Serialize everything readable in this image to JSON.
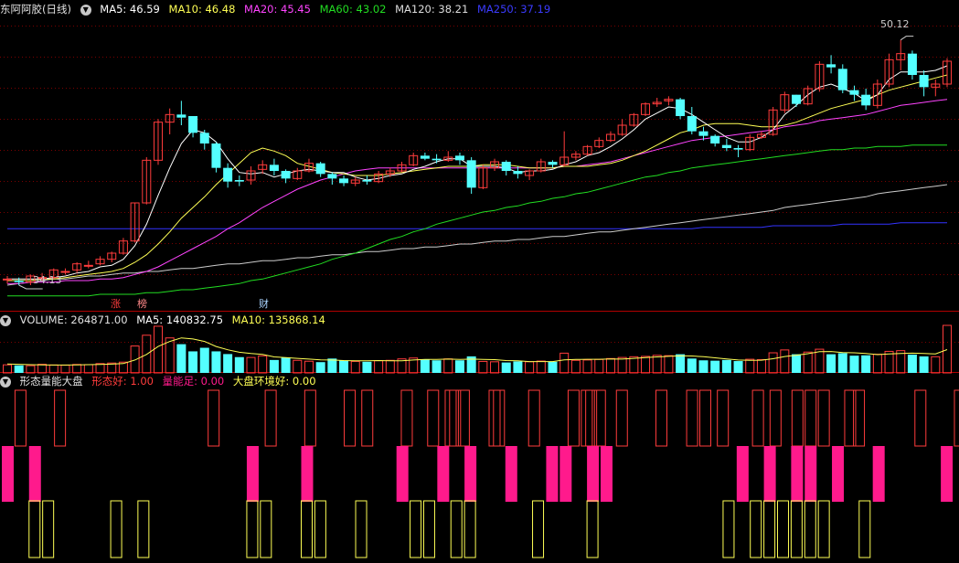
{
  "main": {
    "stock": "东阿阿胶(日线)",
    "ma5": "MA5: 46.59",
    "ma10": "MA10: 46.48",
    "ma20": "MA20: 45.45",
    "ma60": "MA60: 43.02",
    "ma120": "MA120: 38.21",
    "ma250": "MA250: 37.19",
    "high_label": "50.12",
    "low_label": "34.13",
    "events": [
      "涨",
      "榜",
      "财"
    ]
  },
  "volume": {
    "title": "VOLUME: 264871.00",
    "ma5": "MA5: 140832.75",
    "ma10": "MA10: 135868.14"
  },
  "indicator": {
    "name": "形态量能大盘",
    "f1": "形态好: 1.00",
    "f2": "量能足: 0.00",
    "f3": "大盘环境好: 0.00"
  },
  "colors": {
    "up": "#ff3c3c",
    "down": "#54ffff",
    "ma5": "#ffffff",
    "ma10": "#ffff55",
    "ma20": "#ff44ff",
    "ma60": "#22dd22",
    "ma120": "#cccccc",
    "ma250": "#3333ff",
    "pink": "#ff1a8c",
    "yellow": "#ffff55",
    "grid": "#7a0000"
  },
  "chart_data": {
    "type": "candlestick",
    "candles": [
      [
        34.5,
        34.7,
        34.2,
        34.5
      ],
      [
        34.4,
        34.6,
        34.1,
        34.3
      ],
      [
        34.3,
        34.8,
        34.1,
        34.7
      ],
      [
        34.6,
        34.9,
        34.4,
        34.6
      ],
      [
        34.6,
        35.2,
        34.5,
        35.1
      ],
      [
        35.0,
        35.2,
        34.8,
        35.0
      ],
      [
        35.1,
        35.6,
        34.9,
        35.5
      ],
      [
        35.4,
        35.7,
        35.2,
        35.4
      ],
      [
        35.5,
        36.0,
        35.4,
        35.8
      ],
      [
        35.8,
        36.3,
        35.6,
        36.2
      ],
      [
        36.2,
        37.2,
        36.1,
        37.0
      ],
      [
        37.0,
        39.5,
        36.9,
        39.5
      ],
      [
        39.5,
        42.5,
        39.4,
        42.3
      ],
      [
        42.3,
        45.0,
        42.0,
        44.8
      ],
      [
        44.8,
        45.7,
        44.0,
        45.3
      ],
      [
        45.3,
        46.2,
        44.6,
        45.1
      ],
      [
        45.2,
        45.2,
        43.8,
        44.1
      ],
      [
        44.1,
        44.3,
        43.0,
        43.4
      ],
      [
        43.4,
        43.5,
        41.5,
        41.8
      ],
      [
        41.8,
        42.1,
        40.5,
        40.9
      ],
      [
        41.0,
        41.3,
        40.6,
        40.9
      ],
      [
        41.0,
        41.9,
        40.7,
        41.6
      ],
      [
        41.7,
        42.3,
        41.4,
        42.0
      ],
      [
        42.0,
        42.4,
        41.3,
        41.6
      ],
      [
        41.6,
        41.7,
        40.8,
        41.1
      ],
      [
        41.1,
        41.8,
        41.0,
        41.6
      ],
      [
        41.6,
        42.4,
        41.5,
        42.1
      ],
      [
        42.1,
        42.2,
        41.2,
        41.4
      ],
      [
        41.4,
        41.5,
        40.7,
        41.1
      ],
      [
        41.1,
        41.3,
        40.6,
        40.8
      ],
      [
        40.8,
        41.2,
        40.6,
        41.0
      ],
      [
        41.0,
        41.3,
        40.7,
        40.9
      ],
      [
        40.9,
        41.6,
        40.8,
        41.4
      ],
      [
        41.4,
        41.8,
        41.2,
        41.6
      ],
      [
        41.6,
        42.2,
        41.5,
        42.0
      ],
      [
        42.0,
        42.8,
        41.9,
        42.6
      ],
      [
        42.6,
        42.8,
        42.3,
        42.4
      ],
      [
        42.4,
        42.7,
        42.1,
        42.3
      ],
      [
        42.3,
        42.9,
        42.2,
        42.5
      ],
      [
        42.6,
        42.8,
        42.0,
        42.3
      ],
      [
        42.3,
        42.5,
        40.1,
        40.5
      ],
      [
        40.5,
        42.0,
        40.4,
        41.8
      ],
      [
        41.8,
        42.4,
        41.6,
        42.2
      ],
      [
        42.2,
        42.3,
        41.3,
        41.6
      ],
      [
        41.6,
        41.9,
        41.1,
        41.4
      ],
      [
        41.3,
        41.7,
        41.0,
        41.6
      ],
      [
        41.6,
        42.4,
        41.5,
        42.2
      ],
      [
        42.2,
        42.3,
        41.8,
        42.0
      ],
      [
        42.0,
        44.2,
        41.9,
        42.5
      ],
      [
        42.5,
        42.9,
        42.3,
        42.7
      ],
      [
        42.7,
        43.3,
        42.6,
        43.2
      ],
      [
        43.2,
        43.8,
        43.1,
        43.6
      ],
      [
        43.6,
        44.2,
        43.5,
        44.0
      ],
      [
        44.0,
        45.0,
        43.9,
        44.6
      ],
      [
        44.6,
        45.4,
        44.5,
        45.3
      ],
      [
        45.3,
        46.1,
        45.2,
        46.0
      ],
      [
        46.0,
        46.4,
        45.8,
        46.1
      ],
      [
        46.2,
        46.5,
        45.9,
        46.3
      ],
      [
        46.3,
        46.4,
        45.0,
        45.2
      ],
      [
        45.2,
        45.8,
        44.0,
        44.2
      ],
      [
        44.2,
        44.5,
        43.6,
        43.9
      ],
      [
        43.9,
        44.0,
        43.2,
        43.4
      ],
      [
        43.3,
        43.7,
        42.9,
        43.1
      ],
      [
        43.1,
        43.3,
        42.5,
        43.0
      ],
      [
        43.0,
        44.0,
        42.9,
        43.8
      ],
      [
        43.8,
        44.2,
        43.7,
        44.0
      ],
      [
        44.0,
        45.8,
        43.9,
        45.6
      ],
      [
        45.6,
        46.8,
        45.4,
        46.6
      ],
      [
        46.6,
        46.6,
        45.8,
        46.0
      ],
      [
        46.0,
        47.2,
        45.9,
        47.0
      ],
      [
        47.0,
        48.8,
        46.8,
        48.6
      ],
      [
        48.6,
        49.2,
        48.0,
        48.4
      ],
      [
        48.3,
        48.6,
        46.7,
        46.9
      ],
      [
        46.9,
        47.2,
        46.2,
        46.6
      ],
      [
        46.6,
        47.0,
        45.6,
        45.9
      ],
      [
        45.9,
        47.6,
        45.7,
        47.3
      ],
      [
        47.3,
        49.3,
        47.1,
        48.9
      ],
      [
        48.9,
        50.2,
        48.2,
        49.3
      ],
      [
        49.3,
        49.5,
        47.6,
        47.9
      ],
      [
        47.9,
        48.2,
        46.5,
        47.1
      ],
      [
        47.1,
        47.6,
        46.5,
        47.3
      ],
      [
        47.3,
        49.0,
        47.1,
        48.8
      ]
    ],
    "volume": [
      45000,
      42000,
      40000,
      48000,
      44000,
      43000,
      47000,
      46000,
      52000,
      55000,
      60000,
      150000,
      210000,
      260000,
      195000,
      160000,
      120000,
      140000,
      120000,
      105000,
      88000,
      86000,
      95000,
      72000,
      86000,
      70000,
      65000,
      60000,
      80000,
      70000,
      64000,
      62000,
      68000,
      70000,
      78000,
      83000,
      76000,
      70000,
      78000,
      70000,
      92000,
      64000,
      62000,
      58000,
      64000,
      62000,
      66000,
      62000,
      110000,
      70000,
      72000,
      75000,
      80000,
      86000,
      90000,
      92000,
      98000,
      96000,
      104000,
      80000,
      70000,
      68000,
      72000,
      66000,
      76000,
      74000,
      112000,
      128000,
      104000,
      116000,
      132000,
      104000,
      110000,
      96000,
      98000,
      104000,
      120000,
      124000,
      102000,
      92000,
      90000,
      264871
    ],
    "vol_ma5": [
      50000,
      48000,
      46000,
      45000,
      44000,
      44000,
      45000,
      46000,
      47000,
      49000,
      52000,
      72000,
      103000,
      147000,
      175000,
      195000,
      189000,
      175000,
      147000,
      129000,
      115000,
      108000,
      103000,
      89000,
      85000,
      81000,
      77000,
      73000,
      72000,
      69000,
      68000,
      67000,
      69000,
      68000,
      68000,
      72000,
      75000,
      75000,
      77000,
      75000,
      77000,
      75000,
      74000,
      69000,
      68000,
      63000,
      63000,
      63000,
      73000,
      75000,
      76000,
      76000,
      78000,
      77000,
      81000,
      85000,
      89000,
      92000,
      96000,
      94000,
      90000,
      84000,
      78000,
      72000,
      70000,
      71000,
      79000,
      91000,
      99000,
      107000,
      118000,
      119000,
      113000,
      112000,
      108000,
      102000,
      106000,
      108000,
      110000,
      108000,
      106000,
      130000
    ],
    "formation_good": [
      3,
      12,
      47,
      60,
      69,
      78,
      82,
      91,
      97,
      101,
      102,
      104,
      111,
      112,
      120,
      129,
      132,
      133,
      135,
      140,
      149,
      156,
      159,
      163,
      171,
      175,
      180,
      183,
      186,
      192,
      194,
      208,
      217
    ],
    "pink_bars": [
      0,
      2,
      18,
      22,
      29,
      32,
      34,
      37,
      40,
      41,
      43,
      44,
      54,
      56,
      58,
      59,
      61,
      64,
      69
    ],
    "yellow_bars": [
      2,
      3,
      8,
      10,
      18,
      19,
      22,
      23,
      26,
      30,
      31,
      33,
      34,
      39,
      43,
      53,
      55,
      56,
      57,
      58,
      59,
      60,
      63
    ],
    "ylim": [
      33.5,
      51.5
    ],
    "ma5": [
      34.5,
      34.5,
      34.5,
      34.5,
      34.6,
      34.7,
      34.9,
      35.0,
      35.3,
      35.4,
      35.8,
      36.7,
      38.1,
      40.0,
      41.8,
      43.4,
      44.3,
      44.1,
      43.5,
      42.4,
      41.5,
      41.4,
      41.5,
      41.2,
      41.4,
      41.6,
      41.7,
      41.6,
      41.5,
      41.5,
      41.2,
      41.0,
      41.1,
      41.3,
      41.4,
      41.7,
      41.9,
      42.2,
      42.4,
      42.4,
      41.9,
      41.9,
      41.9,
      41.8,
      41.5,
      41.6,
      41.6,
      41.7,
      42.0,
      42.2,
      42.6,
      42.8,
      43.2,
      43.7,
      44.3,
      45.0,
      45.4,
      45.8,
      45.7,
      45.3,
      44.8,
      44.3,
      43.8,
      43.5,
      43.5,
      43.8,
      44.3,
      45.3,
      45.9,
      46.6,
      47.1,
      47.3,
      47.0,
      46.7,
      46.2,
      46.6,
      47.6,
      48.1,
      48.1,
      48.1,
      48.2,
      48.5
    ],
    "ma10": [
      34.4,
      34.4,
      34.4,
      34.5,
      34.5,
      34.6,
      34.7,
      34.8,
      34.9,
      35.0,
      35.2,
      35.6,
      36.1,
      36.8,
      37.6,
      38.5,
      39.2,
      39.9,
      40.7,
      41.4,
      42.1,
      42.8,
      43.1,
      42.9,
      42.6,
      42.1,
      41.9,
      41.7,
      41.5,
      41.4,
      41.3,
      41.3,
      41.3,
      41.4,
      41.5,
      41.6,
      41.7,
      41.8,
      41.9,
      41.9,
      41.9,
      42.0,
      42.0,
      42.0,
      41.9,
      41.8,
      41.8,
      41.8,
      41.9,
      41.9,
      41.9,
      42.0,
      42.1,
      42.3,
      42.6,
      42.9,
      43.3,
      43.7,
      44.1,
      44.3,
      44.6,
      44.7,
      44.7,
      44.7,
      44.6,
      44.5,
      44.5,
      44.6,
      44.8,
      45.1,
      45.4,
      45.7,
      45.9,
      46.1,
      46.3,
      46.6,
      46.9,
      47.1,
      47.3,
      47.5,
      47.7,
      47.9
    ],
    "ma20": [
      34.2,
      34.2,
      34.3,
      34.3,
      34.3,
      34.4,
      34.4,
      34.4,
      34.5,
      34.5,
      34.6,
      34.8,
      35.0,
      35.3,
      35.7,
      36.1,
      36.5,
      36.9,
      37.3,
      37.8,
      38.2,
      38.7,
      39.2,
      39.6,
      40.0,
      40.4,
      40.7,
      41.0,
      41.2,
      41.4,
      41.6,
      41.7,
      41.8,
      41.8,
      41.8,
      41.8,
      41.8,
      41.8,
      41.8,
      41.8,
      41.8,
      41.8,
      41.8,
      41.8,
      41.8,
      41.8,
      41.8,
      41.8,
      41.9,
      41.9,
      42.0,
      42.1,
      42.2,
      42.4,
      42.6,
      42.8,
      43.0,
      43.2,
      43.4,
      43.6,
      43.7,
      43.8,
      43.9,
      44.0,
      44.1,
      44.2,
      44.3,
      44.5,
      44.6,
      44.7,
      44.9,
      45.0,
      45.1,
      45.2,
      45.3,
      45.5,
      45.7,
      45.9,
      46.0,
      46.1,
      46.2,
      46.3
    ],
    "ma60": [
      33.4,
      33.4,
      33.4,
      33.4,
      33.4,
      33.4,
      33.4,
      33.4,
      33.5,
      33.5,
      33.5,
      33.5,
      33.6,
      33.6,
      33.7,
      33.8,
      33.8,
      33.9,
      34.0,
      34.1,
      34.2,
      34.4,
      34.5,
      34.7,
      34.9,
      35.1,
      35.3,
      35.5,
      35.8,
      36.0,
      36.2,
      36.5,
      36.8,
      37.1,
      37.3,
      37.6,
      37.8,
      38.1,
      38.3,
      38.5,
      38.7,
      38.9,
      39.0,
      39.2,
      39.3,
      39.5,
      39.6,
      39.8,
      39.9,
      40.1,
      40.2,
      40.4,
      40.6,
      40.8,
      41.0,
      41.2,
      41.3,
      41.5,
      41.6,
      41.8,
      41.9,
      42.0,
      42.1,
      42.2,
      42.3,
      42.4,
      42.5,
      42.6,
      42.7,
      42.8,
      42.9,
      43.0,
      43.0,
      43.1,
      43.1,
      43.2,
      43.2,
      43.2,
      43.3,
      43.3,
      43.3,
      43.3
    ],
    "ma120": [
      34.1,
      34.2,
      34.3,
      34.4,
      34.5,
      34.5,
      34.6,
      34.7,
      34.7,
      34.8,
      34.9,
      34.9,
      35.0,
      35.0,
      35.1,
      35.2,
      35.2,
      35.3,
      35.4,
      35.5,
      35.5,
      35.6,
      35.7,
      35.7,
      35.8,
      35.9,
      35.9,
      36.0,
      36.1,
      36.1,
      36.2,
      36.3,
      36.3,
      36.4,
      36.5,
      36.5,
      36.6,
      36.6,
      36.7,
      36.8,
      36.8,
      36.9,
      37.0,
      37.0,
      37.1,
      37.1,
      37.2,
      37.3,
      37.3,
      37.4,
      37.5,
      37.6,
      37.6,
      37.7,
      37.8,
      37.9,
      38.0,
      38.1,
      38.2,
      38.3,
      38.4,
      38.5,
      38.6,
      38.7,
      38.8,
      38.9,
      39.0,
      39.2,
      39.3,
      39.4,
      39.5,
      39.6,
      39.7,
      39.8,
      39.9,
      40.1,
      40.2,
      40.3,
      40.4,
      40.5,
      40.6,
      40.7
    ],
    "ma250": [
      37.8,
      37.8,
      37.8,
      37.8,
      37.8,
      37.8,
      37.8,
      37.8,
      37.8,
      37.8,
      37.8,
      37.8,
      37.8,
      37.8,
      37.8,
      37.8,
      37.8,
      37.8,
      37.8,
      37.8,
      37.8,
      37.8,
      37.8,
      37.8,
      37.8,
      37.8,
      37.8,
      37.8,
      37.8,
      37.8,
      37.8,
      37.8,
      37.8,
      37.8,
      37.8,
      37.8,
      37.8,
      37.8,
      37.8,
      37.8,
      37.8,
      37.8,
      37.8,
      37.8,
      37.8,
      37.8,
      37.8,
      37.8,
      37.8,
      37.8,
      37.8,
      37.8,
      37.8,
      37.8,
      37.8,
      37.8,
      37.8,
      37.8,
      37.8,
      37.8,
      37.9,
      37.9,
      37.9,
      37.9,
      37.9,
      37.9,
      38.0,
      38.0,
      38.0,
      38.0,
      38.0,
      38.0,
      38.1,
      38.1,
      38.1,
      38.1,
      38.1,
      38.2,
      38.2,
      38.2,
      38.2,
      38.2
    ]
  }
}
